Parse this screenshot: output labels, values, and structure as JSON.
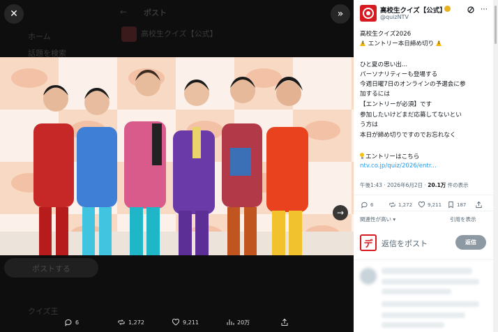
{
  "viewer": {
    "background_ghost": {
      "back_label": "←",
      "header_label": "ポスト",
      "left_label_1": "ホーム",
      "left_label_2": "話題を検索",
      "ghost_account": "高校生クイズ【公式】",
      "post_button": "ポストする",
      "ghost_bottom": "クイズ王"
    },
    "close_icon": "✕",
    "collapse_icon": "»",
    "next_icon": "→",
    "actions": {
      "replies": "6",
      "reposts": "1,272",
      "likes": "9,211",
      "views": "20万"
    }
  },
  "tweet": {
    "display_name": "高校生クイズ【公式】",
    "handle": "@quizNTV",
    "lines": [
      "高校生クイズ2026",
      "エントリー本日締め切り",
      "ひと夏の思い出...",
      "パーソナリティーも登場する",
      "今週日曜7日のオンラインの予選会に参",
      "加するには",
      "【エントリーが必須】です",
      "参加したいけどまだ応募してないとい",
      "う方は",
      "本日が締め切りですのでお忘れなく",
      "エントリーはこちら",
      "ntv.co.jp/quiz/2026/entr..."
    ],
    "meta_time": "午後1:43 · 2026年6月2日 · ",
    "meta_views": "20.1万",
    "meta_views_suffix": " 件の表示",
    "actions": {
      "replies": "6",
      "reposts": "1,272",
      "likes": "9,211",
      "bookmarks": "187"
    },
    "sort_label": "関連性が高い",
    "quote_link": "引用を表示",
    "reply_avatar_glyph": "デ",
    "reply_placeholder": "返信をポスト",
    "reply_button": "返信"
  },
  "colors": {
    "accent": "#1d9bf0",
    "brand_red": "#d71920",
    "verified": "#e8b21e"
  }
}
